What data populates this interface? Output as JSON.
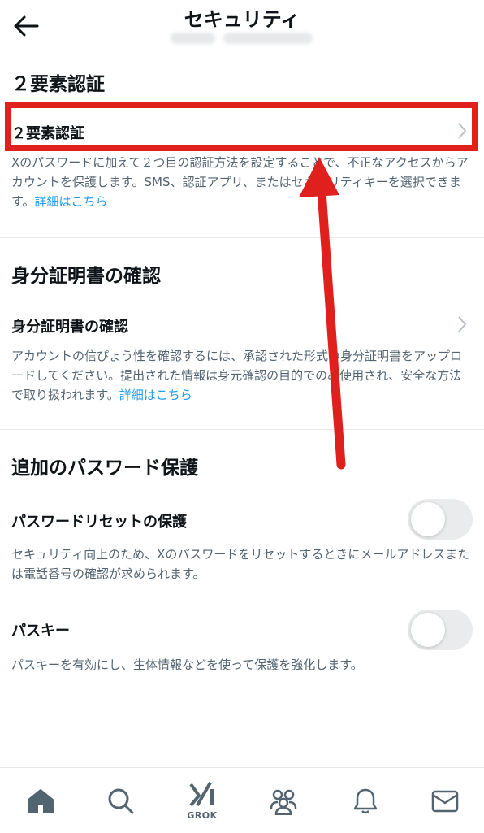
{
  "header": {
    "title": "セキュリティ"
  },
  "sections": [
    {
      "title": "２要素認証",
      "item_label": "２要素認証",
      "description": "Xのパスワードに加えて２つ目の認証方法を設定することで、不正なアクセスからアカウントを保護します。SMS、認証アプリ、またはセキュリティキーを選択できます。",
      "link": "詳細はこちら"
    },
    {
      "title": "身分証明書の確認",
      "item_label": "身分証明書の確認",
      "description": "アカウントの信ぴょう性を確認するには、承認された形式の身分証明書をアップロードしてください。提出された情報は身元確認の目的でのみ使用され、安全な方法で取り扱われます。",
      "link": "詳細はこちら"
    },
    {
      "title": "追加のパスワード保護",
      "toggles": [
        {
          "label": "パスワードリセットの保護",
          "description": "セキュリティ向上のため、Xのパスワードをリセットするときにメールアドレスまたは電話番号の確認が求められます。",
          "enabled": false
        },
        {
          "label": "パスキー",
          "description": "パスキーを有効にし、生体情報などを使って保護を強化します。",
          "enabled": false
        }
      ]
    }
  ],
  "bottom_nav": {
    "items": [
      "home-icon",
      "search-icon",
      "grok-icon",
      "communities-icon",
      "notifications-icon",
      "messages-icon"
    ],
    "grok_label": "GROK"
  },
  "colors": {
    "link": "#1d9bf0",
    "annotation_red": "#e0201c",
    "secondary_text": "#536471"
  }
}
